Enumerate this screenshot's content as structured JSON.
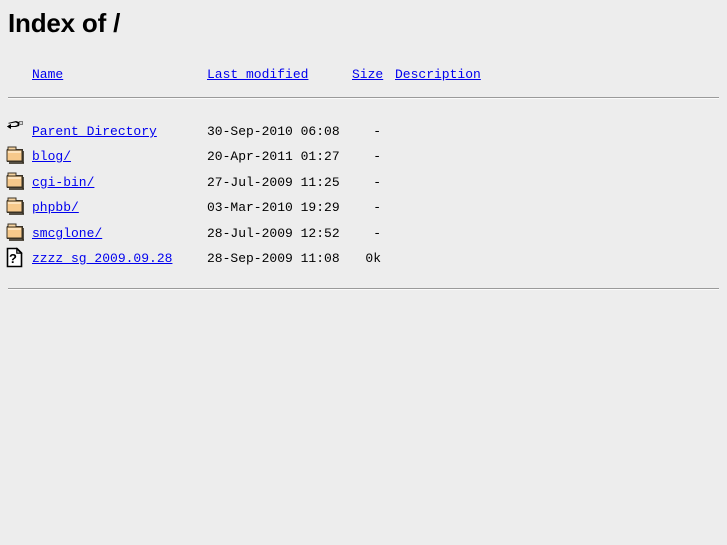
{
  "page": {
    "title": "Index of /",
    "background_color": "#ededed",
    "link_color": "#0000ee",
    "text_color": "#000000",
    "rule_color": "#9a9a9a"
  },
  "table": {
    "headers": {
      "name": "Name",
      "last_modified": "Last modified",
      "size": "Size",
      "description": "Description"
    },
    "rows": [
      {
        "icon": "back-arrow-icon",
        "name": "Parent Directory",
        "last_modified": "30-Sep-2010 06:08",
        "size": "-",
        "description": ""
      },
      {
        "icon": "folder-icon",
        "name": "blog/",
        "last_modified": "20-Apr-2011 01:27",
        "size": "-",
        "description": ""
      },
      {
        "icon": "folder-icon",
        "name": "cgi-bin/",
        "last_modified": "27-Jul-2009 11:25",
        "size": "-",
        "description": ""
      },
      {
        "icon": "folder-icon",
        "name": "phpbb/",
        "last_modified": "03-Mar-2010 19:29",
        "size": "-",
        "description": ""
      },
      {
        "icon": "folder-icon",
        "name": "smcglone/",
        "last_modified": "28-Jul-2009 12:52",
        "size": "-",
        "description": ""
      },
      {
        "icon": "unknown-file-icon",
        "name": "zzzz_sg_2009.09.28",
        "last_modified": "28-Sep-2009 11:08",
        "size": "0k",
        "description": ""
      }
    ]
  }
}
